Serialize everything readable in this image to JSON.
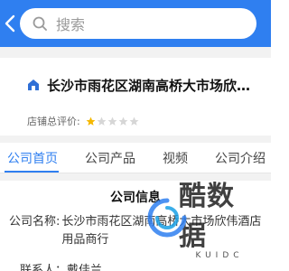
{
  "header": {
    "back_icon": "chevron-left-icon",
    "search_placeholder": "搜索",
    "colors": {
      "bar": "#2f7ff0"
    }
  },
  "company": {
    "name": "长沙市雨花区湖南高桥大市场欣伟..."
  },
  "rating": {
    "label": "店铺总评价:",
    "stars_total": 5,
    "stars_filled": 1
  },
  "tabs": [
    {
      "label": "公司首页",
      "active": true
    },
    {
      "label": "公司产品",
      "active": false
    },
    {
      "label": "视频",
      "active": false
    },
    {
      "label": "公司介绍",
      "active": false
    }
  ],
  "info": {
    "title": "公司信息",
    "name_key": "公司名称:",
    "name_value": "长沙市雨花区湖南高桥大市场欣伟酒店用品商行",
    "contact_key": "联系人：",
    "contact_value": "戴佳兰"
  },
  "watermark": {
    "text": "酷数据",
    "sub": "KUIDC"
  }
}
